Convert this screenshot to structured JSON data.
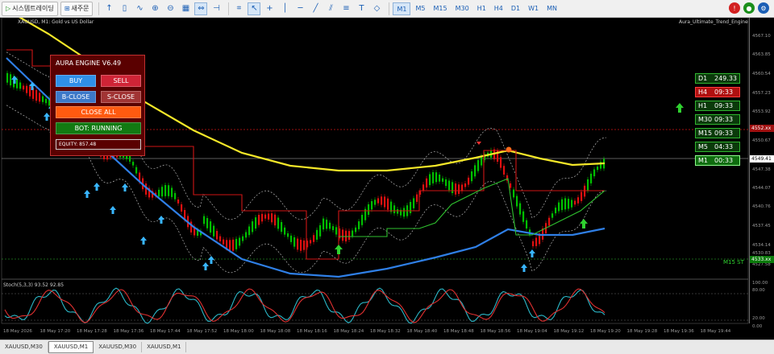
{
  "toolbar": {
    "algo_button": "시스템트레이딩",
    "order_button": "새주문",
    "timeframes": [
      "M1",
      "M5",
      "M15",
      "M30",
      "H1",
      "H4",
      "D1",
      "W1",
      "MN"
    ],
    "active_timeframe": "M1",
    "icons": [
      "add-indicator-icon",
      "candles-icon",
      "line-chart-icon",
      "zoom-in-icon",
      "zoom-out-icon",
      "grid-icon",
      "autoscroll-icon",
      "chart-shift-icon",
      "screenshot-icon",
      "cursor-icon",
      "crosshair-icon",
      "vertical-line-icon",
      "horizontal-line-icon",
      "trend-line-icon",
      "channel-icon",
      "text-icon",
      "shapes-icon"
    ]
  },
  "chart": {
    "symbol_title": "XAUUSD, M1:  Gold vs US Dollar",
    "indicator_name": "Aura_Ultimate_Trend_Engine",
    "bottom_label": "M15 ST",
    "stoch_title": "Stoch(5,3,3) 93.52 92.85",
    "price_ticks": [
      "4567.10",
      "4563.85",
      "4560.54",
      "4557.23",
      "4553.92",
      "4550.67",
      "4547.38",
      "4544.07",
      "4540.76",
      "4537.45",
      "4534.14",
      "4530.83",
      "4527.58"
    ],
    "current_price": "4549.41",
    "red_level": "4552.xx",
    "green_level": "4533.xx",
    "stoch_ticks": [
      "100.00",
      "80.00",
      "20.00",
      "0.00"
    ],
    "time_ticks": [
      "18 May 2026",
      "18 May 17:20",
      "18 May 17:28",
      "18 May 17:36",
      "18 May 17:44",
      "18 May 17:52",
      "18 May 18:00",
      "18 May 18:08",
      "18 May 18:16",
      "18 May 18:24",
      "18 May 18:32",
      "18 May 18:40",
      "18 May 18:48",
      "18 May 18:56",
      "18 May 19:04",
      "18 May 19:12",
      "18 May 19:20",
      "18 May 19:28",
      "18 May 19:36",
      "18 May 19:44"
    ]
  },
  "panel": {
    "title": "AURA ENGINE V6.49",
    "buy": "BUY",
    "sell": "SELL",
    "bclose": "B-CLOSE",
    "sclose": "S-CLOSE",
    "close_all": "CLOSE ALL",
    "bot": "BOT: RUNNING",
    "equity": "EQUITY: 857.48"
  },
  "timeframe_boxes": [
    {
      "tf": "D1",
      "value": "249.33",
      "state": "green"
    },
    {
      "tf": "H4",
      "value": "09:33",
      "state": "red"
    },
    {
      "tf": "H1",
      "value": "09:33",
      "state": "green"
    },
    {
      "tf": "M30",
      "value": "09:33",
      "state": "green"
    },
    {
      "tf": "M15",
      "value": "09:33",
      "state": "green"
    },
    {
      "tf": "M5",
      "value": "04:33",
      "state": "green"
    },
    {
      "tf": "M1",
      "value": "00:33",
      "state": "bright"
    }
  ],
  "tabs": [
    "XAUUSD,M30",
    "XAUUSD,M1",
    "XAUUSD,M30",
    "XAUUSD,M1"
  ],
  "active_tab": 1,
  "colors": {
    "bull": "#00c000",
    "bear": "#e01010",
    "ema": "#f5e829",
    "ma_blue": "#2f7fe6",
    "trail_red": "#d01515",
    "trail_green": "#2fc12f"
  }
}
